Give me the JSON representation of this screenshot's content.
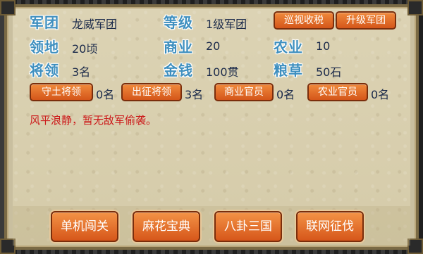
{
  "stats": {
    "corps_label": "军团",
    "corps_value": "龙威军团",
    "level_label": "等级",
    "level_value": "1级军团",
    "territory_label": "领地",
    "territory_value": "20顷",
    "commerce_label": "商业",
    "commerce_value": "20",
    "agriculture_label": "农业",
    "agriculture_value": "10",
    "generals_label": "将领",
    "generals_value": "3名",
    "money_label": "金钱",
    "money_value": "100贯",
    "grain_label": "粮草",
    "grain_value": "50石"
  },
  "actions": {
    "patrol_tax": "巡视收税",
    "upgrade_corps": "升级军团"
  },
  "assignments": [
    {
      "label": "守土将领",
      "count": "0名"
    },
    {
      "label": "出征将领",
      "count": "3名"
    },
    {
      "label": "商业官员",
      "count": "0名"
    },
    {
      "label": "农业官员",
      "count": "0名"
    }
  ],
  "message": "风平浪静，暂无敌军偷袭。",
  "menu": [
    {
      "label": "单机闯关"
    },
    {
      "label": "麻花宝典"
    },
    {
      "label": "八卦三国"
    },
    {
      "label": "联网征伐"
    }
  ],
  "colors": {
    "label_blue": "#3e8fbf",
    "button_orange": "#e0692a",
    "message_red": "#cc1a1a"
  }
}
